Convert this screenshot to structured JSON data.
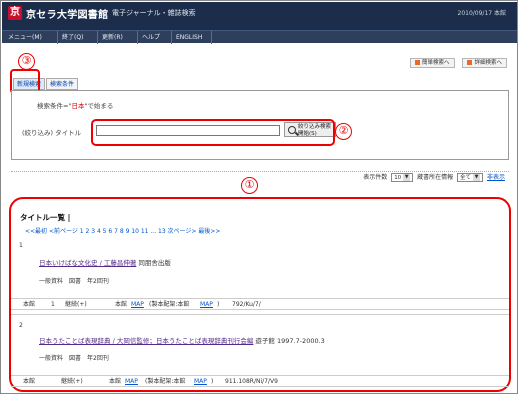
{
  "header": {
    "logo": "京",
    "library_name": "京セラ大学図書館",
    "subtitle": "電子ジャーナル・雑誌検索",
    "date": "2010/09/17 本館"
  },
  "menu": [
    {
      "label": "メニュー(M)"
    },
    {
      "label": "終了(Q)"
    },
    {
      "label": "更新(R)"
    },
    {
      "label": "ヘルプ"
    },
    {
      "label": "ENGLISH"
    }
  ],
  "top_buttons": {
    "simple": "簡単検索へ",
    "advanced": "詳細検索へ"
  },
  "tabs": {
    "new_search": "新規検索",
    "search_conditions": "検索条件"
  },
  "search_panel": {
    "condition_prefix": "検索条件=\"",
    "condition_keyword": "日本",
    "condition_suffix": "\"で始まる",
    "title_label": "(絞り込み) タイトル",
    "title_value": "",
    "search_button_line1": "絞り込み検索",
    "search_button_line2": "開始(S)"
  },
  "annotations": {
    "one": "①",
    "two": "②",
    "three": "③"
  },
  "display": {
    "count_label": "表示件数",
    "count_value": "10",
    "holding_label": "蔵書所在情報",
    "holding_value": "全て",
    "sort_link": "非表示"
  },
  "results": {
    "list_title": "タイトル一覧 |",
    "pager": "<<最初 <前ページ 1 2 3 4 5 6 7 8 9 10 11 ... 13 次ページ> 最後>>",
    "records": [
      {
        "num": "1",
        "title": "日本いけばな文化史 / 工藤昌伸著",
        "publisher": "同朋舎出版",
        "meta": "一般資料　図書　年2回刊",
        "holding": {
          "location": "本館",
          "count": "1",
          "status": "継続(+)",
          "place": "本館",
          "map": "MAP",
          "note": "(製本配架:本館",
          "note_map": "MAP",
          "note_end": ")",
          "call_no": "792/Ku/7/"
        }
      },
      {
        "num": "2",
        "title": "日本うたことば表現辞典 / 大岡信監修；日本うたことば表現辞典刊行会編",
        "publisher": "遊子館 1997.7-2000.3",
        "meta": "一般資料　図書　年2回刊",
        "holding": {
          "location": "本館",
          "count": "",
          "status": "継続(+)",
          "place": "本館",
          "map": "MAP",
          "note": "(製本配架:本館",
          "note_map": "MAP",
          "note_end": ")",
          "call_no": "911.108R/Ni/7/V9"
        }
      }
    ]
  },
  "colors": {
    "header_bg": "#1b2d4a",
    "menu_bg": "#2d3f5c",
    "annotation_red": "#e00000",
    "link": "#0055cc"
  }
}
